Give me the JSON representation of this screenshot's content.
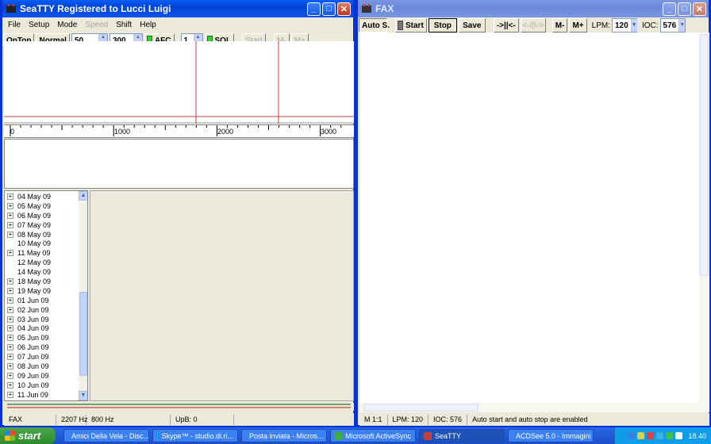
{
  "seatty": {
    "title": "SeaTTY    Registered to Lucci Luigi",
    "menu": [
      {
        "label": "File",
        "enabled": true
      },
      {
        "label": "Setup",
        "enabled": true
      },
      {
        "label": "Mode",
        "enabled": true
      },
      {
        "label": "Speed",
        "enabled": false
      },
      {
        "label": "Shift",
        "enabled": true
      },
      {
        "label": "Help",
        "enabled": true
      }
    ],
    "toolbar": {
      "ontop": "OnTop",
      "normal": "Normal",
      "spin1": "50",
      "spin2": "300",
      "afc": "AFC",
      "spin3": "1",
      "sql": "SQL",
      "start": "Start",
      "mminus": "M-",
      "mplus": "M+"
    },
    "scale": [
      "0",
      "1000",
      "2000",
      "3000"
    ],
    "tree": [
      {
        "label": "04 May 09",
        "expandable": true
      },
      {
        "label": "05 May 09",
        "expandable": true
      },
      {
        "label": "06 May 09",
        "expandable": true
      },
      {
        "label": "07 May 09",
        "expandable": true
      },
      {
        "label": "08 May 09",
        "expandable": true
      },
      {
        "label": "10 May 09",
        "expandable": false
      },
      {
        "label": "11 May 09",
        "expandable": true
      },
      {
        "label": "12 May 09",
        "expandable": false
      },
      {
        "label": "14 May 09",
        "expandable": false
      },
      {
        "label": "18 May 09",
        "expandable": true
      },
      {
        "label": "19 May 09",
        "expandable": true
      },
      {
        "label": "01 Jun 09",
        "expandable": true
      },
      {
        "label": "02 Jun 09",
        "expandable": true
      },
      {
        "label": "03 Jun 09",
        "expandable": true
      },
      {
        "label": "04 Jun 09",
        "expandable": true
      },
      {
        "label": "05 Jun 09",
        "expandable": true
      },
      {
        "label": "06 Jun 09",
        "expandable": true
      },
      {
        "label": "07 Jun 09",
        "expandable": true
      },
      {
        "label": "08 Jun 09",
        "expandable": true
      },
      {
        "label": "09 Jun 09",
        "expandable": true
      },
      {
        "label": "10 Jun 09",
        "expandable": true
      },
      {
        "label": "11 Jun 09",
        "expandable": true
      }
    ],
    "status": {
      "mode": "FAX",
      "freq": "2207 Hz",
      "shift": "800 Hz",
      "upb": "UpB: 0"
    }
  },
  "fax": {
    "title": "FAX",
    "toolbar": {
      "autos": "Auto S.",
      "start": "Start",
      "stop": "Stop",
      "save": "Save",
      "sync": "->||<-",
      "slant": "<-/|\\->",
      "mminus": "M-",
      "mplus": "M+",
      "lpm_label": "LPM:",
      "lpm_value": "120",
      "ioc_label": "IOC:",
      "ioc_value": "576"
    },
    "status": {
      "zoom": "M 1:1",
      "lpm": "LPM: 120",
      "ioc": "IOC: 576",
      "msg": "Auto start and auto stop are enabled"
    }
  },
  "taskbar": {
    "start": "start",
    "tasks": [
      {
        "label": "Amici Della Vela - Disc...",
        "icon_color": "#3a8ee6",
        "active": false
      },
      {
        "label": "Skype™ - studio.di.ri...",
        "icon_color": "#00aff0",
        "active": false
      },
      {
        "label": "Posta inviata - Micros...",
        "icon_color": "#f0c040",
        "active": false
      },
      {
        "label": "Microsoft ActiveSync",
        "icon_color": "#3fae3f",
        "active": false
      },
      {
        "label": "SeaTTY",
        "icon_color": "#c04040",
        "active": true
      },
      {
        "label": "ACDSee 5.0 - Immagini",
        "icon_color": "#4060c0",
        "active": false
      }
    ],
    "clock": "18.40"
  }
}
